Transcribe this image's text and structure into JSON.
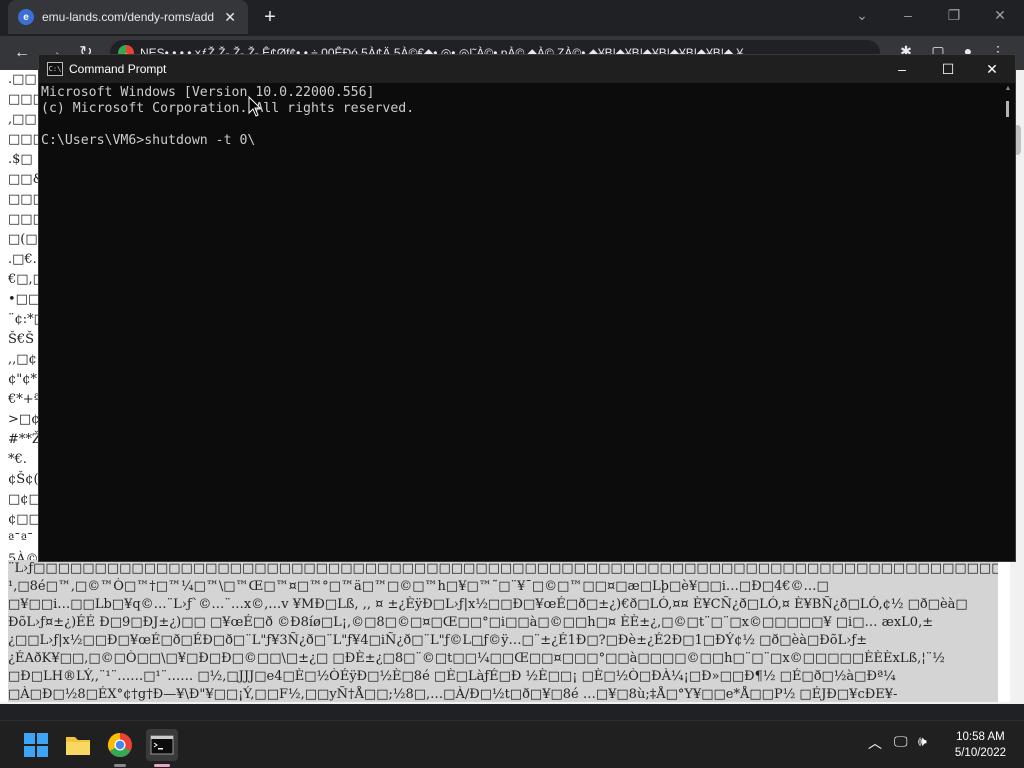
{
  "browser": {
    "tab_title": "emu-lands.com/dendy-roms/add",
    "tab_favicon": "e",
    "new_tab_label": "+",
    "close_tab_label": "✕",
    "address_text": "NES• • • •  xƒŽ Ž- Ž- Ž- Ê¢Øf¢• • ÷ 00ÊÐó 5À¢Ä 5À©€◆• ◎• ◎|˜À©• pÀ© ◆À© ZÀ©• ◆¥B|◆¥B|◆¥B|◆¥B|◆¥B|◆ ¥"
  },
  "cmd": {
    "title": "Command Prompt",
    "lines": [
      "Microsoft Windows [Version 10.0.22000.556]",
      "(c) Microsoft Corporation. All rights reserved.",
      "",
      "C:\\Users\\VM6>shutdown -t 0\\"
    ]
  },
  "page_garble": {
    "left_column": [
      ".□□",
      "□□□",
      ",□□",
      "□□□",
      ".$□",
      "□□&",
      "□□□",
      "□□□",
      "□(□",
      ".□€.",
      "€□,□",
      "•□□",
      "¨¢:*□",
      "Š€Š",
      ",,□¢",
      "¢\"¢*",
      "€*+ª",
      ">□¢",
      "#**Ž",
      "*€.",
      "¢Š¢(",
      "□¢□",
      "¢□□",
      "ª¯ª¯",
      "5À©",
      "ZÀ©",
      "□èĐ",
      "¥□ª"
    ],
    "bottom_lines": [
      "¨L›ƒ□□□□□□□□□□□□□□□□□□□□□□□□□□□□□□□□□□□□□□□□□□□□□□□□□□□□□□□□□□□□□□□□□□□□□□□□□□□□□□□□□□□□",
      "¹,□8é□™,□©™Ò□™†□™¼□™\\□™Œ□™¤□™°□™ä□™□©□™h□¥□™˜□¨¥¯□©□™□□¤□æ□Lþ□è¥□□i…□Đ□4€©…□",
      "□¥□□i…□□Lb□¥q©…¨L›ƒ`©…¨…x©,…v ¥MĐ□Lß, ,, ¤ ±¿ÈÿĐ□L›ƒ|x½□□Đ□¥œÉ□ð□±¿)€ð□LÓ,¤¤ È¥CÑ¿ð□LÓ,¤ È¥BÑ¿ð□LÓ,¢½ □ð□èà□",
      "ĐõL›ƒ¤±¿)ÉÉ Đ□9□ĐJ±¿)□□ □¥œÉ□ð ©Đ8íø□L¡,©□8□©□¤□Œ□□°□i□□à□©□□h□¤ ÈÈ±¿,□©□t¨□¨□x©□□□□□¥ □i□… æxL0,±",
      "¿□□L›ƒ|x½□□Đ□¥œÉ□ð□ÉÐ□ð□¨L\"ƒ¥3Ñ¿ð□¨L\"ƒ¥4□iÑ¿ð□¨L\"ƒ©L□ƒ©ÿ…□¨±¿É1Đ□?□Đè±¿É2Đ□1□ĐÝ¢½ □ð□èà□ĐõL›ƒ±",
      "¿ÉAðK¥□□,□©□Ò□□\\□¥□Đ□Đ□©□□\\□±¿□ □ĐÈ±¿□8□¨©□t□□¼□□Œ□□¤□□□°□□à□□□□©□□h□¨□¨□x©□□□□□ÈÈÈxLß,¦¨½",
      "□Đ□LH®LÝ,,¨¹¨……□¹¨…… □½,□JJJ□e4□È□½ÒÉÿĐ□½È□8é □È□LàƒÉ□Đ ½È□□¡ □È□½Ò□ĐÀ¼¡□Đ»□□Đ¶½ □É□ð□½à□Đª¼",
      "□À□Đ□½8□ÉX°¢†g†Đ—¥\\Đ\"¥□□¡Ý,□□F½,□□yÑ†Å□□;½8□,…□À/Đ□½t□ð□¥□8é …□¥□8ù;‡Å□°Y¥□□e*Å□□P½ □ÉJĐ□¥cĐE¥-"
    ]
  },
  "taskbar": {
    "time": "10:58 AM",
    "date": "5/10/2022"
  }
}
